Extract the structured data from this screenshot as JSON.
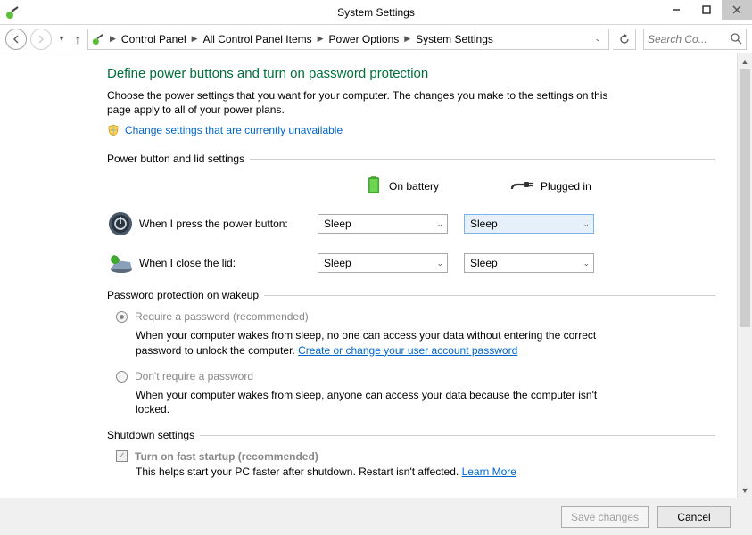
{
  "window": {
    "title": "System Settings"
  },
  "breadcrumb": {
    "items": [
      "Control Panel",
      "All Control Panel Items",
      "Power Options",
      "System Settings"
    ]
  },
  "search": {
    "placeholder": "Search Co..."
  },
  "page": {
    "heading": "Define power buttons and turn on password protection",
    "intro": "Choose the power settings that you want for your computer. The changes you make to the settings on this page apply to all of your power plans.",
    "change_link": "Change settings that are currently unavailable"
  },
  "sections": {
    "power_lid": {
      "title": "Power button and lid settings",
      "col_battery": "On battery",
      "col_plugged": "Plugged in",
      "rows": [
        {
          "label": "When I press the power button:",
          "battery": "Sleep",
          "plugged": "Sleep"
        },
        {
          "label": "When I close the lid:",
          "battery": "Sleep",
          "plugged": "Sleep"
        }
      ]
    },
    "password": {
      "title": "Password protection on wakeup",
      "require": {
        "label": "Require a password (recommended)",
        "desc_a": "When your computer wakes from sleep, no one can access your data without entering the correct password to unlock the computer. ",
        "link": "Create or change your user account password"
      },
      "dont": {
        "label": "Don't require a password",
        "desc": "When your computer wakes from sleep, anyone can access your data because the computer isn't locked."
      }
    },
    "shutdown": {
      "title": "Shutdown settings",
      "fast": {
        "label": "Turn on fast startup (recommended)",
        "desc_a": "This helps start your PC faster after shutdown. Restart isn't affected. ",
        "link": "Learn More"
      }
    }
  },
  "footer": {
    "save": "Save changes",
    "cancel": "Cancel"
  }
}
